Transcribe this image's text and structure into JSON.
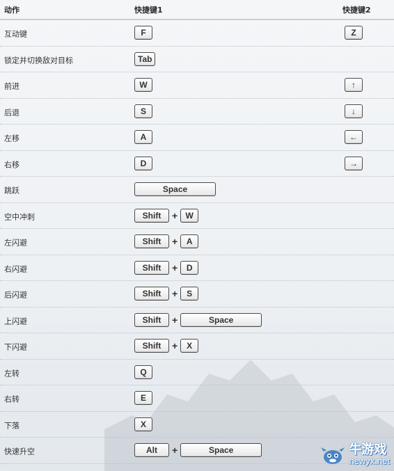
{
  "header": {
    "action": "动作",
    "key1": "快捷键1",
    "key2": "快捷键2"
  },
  "rows": [
    {
      "action": "互动键",
      "keys1": [
        "F"
      ],
      "key2": "Z"
    },
    {
      "action": "锁定并切换敌对目标",
      "keys1": [
        "Tab"
      ],
      "key2": ""
    },
    {
      "action": "前进",
      "keys1": [
        "W"
      ],
      "key2": "↑"
    },
    {
      "action": "后退",
      "keys1": [
        "S"
      ],
      "key2": "↓"
    },
    {
      "action": "左移",
      "keys1": [
        "A"
      ],
      "key2": "←"
    },
    {
      "action": "右移",
      "keys1": [
        "D"
      ],
      "key2": "→"
    },
    {
      "action": "跳跃",
      "keys1": [
        "Space"
      ],
      "key2": ""
    },
    {
      "action": "空中冲刺",
      "keys1": [
        "Shift",
        "W"
      ],
      "key2": ""
    },
    {
      "action": "左闪避",
      "keys1": [
        "Shift",
        "A"
      ],
      "key2": ""
    },
    {
      "action": "右闪避",
      "keys1": [
        "Shift",
        "D"
      ],
      "key2": ""
    },
    {
      "action": "后闪避",
      "keys1": [
        "Shift",
        "S"
      ],
      "key2": ""
    },
    {
      "action": "上闪避",
      "keys1": [
        "Shift",
        "Space"
      ],
      "key2": ""
    },
    {
      "action": "下闪避",
      "keys1": [
        "Shift",
        "X"
      ],
      "key2": ""
    },
    {
      "action": "左转",
      "keys1": [
        "Q"
      ],
      "key2": ""
    },
    {
      "action": "右转",
      "keys1": [
        "E"
      ],
      "key2": ""
    },
    {
      "action": "下落",
      "keys1": [
        "X"
      ],
      "key2": ""
    },
    {
      "action": "快速升空",
      "keys1": [
        "Alt",
        "Space"
      ],
      "key2": ""
    }
  ],
  "plus_sign": "+",
  "logo": {
    "cn": "牛游戏",
    "en": "newyx.net"
  },
  "colors": {
    "logo_blue": "#4a86c5",
    "key_border": "#4a4a4a",
    "divider": "#c9ced3"
  },
  "icons": {
    "mascot": "blue-bull-mascot-icon"
  }
}
